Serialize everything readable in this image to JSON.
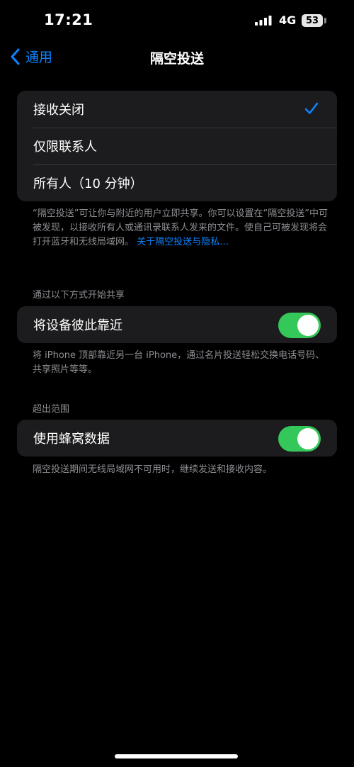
{
  "status_bar": {
    "time": "17:21",
    "network": "4G",
    "battery": "53"
  },
  "nav": {
    "back_label": "通用",
    "title": "隔空投送"
  },
  "receive_options": [
    {
      "label": "接收关闭",
      "selected": true
    },
    {
      "label": "仅限联系人",
      "selected": false
    },
    {
      "label": "所有人（10 分钟）",
      "selected": false
    }
  ],
  "receive_footnote": {
    "text": "“隔空投送”可让你与附近的用户立即共享。你可以设置在“隔空投送”中可被发现，以接收所有人或通讯录联系人发来的文件。使自己可被发现将会打开蓝牙和无线局域网。",
    "link": "关于隔空投送与隐私…"
  },
  "start_sharing": {
    "header": "通过以下方式开始共享",
    "row_label": "将设备彼此靠近",
    "toggle_on": true,
    "footnote": "将 iPhone 顶部靠近另一台 iPhone，通过名片投送轻松交换电话号码、共享照片等等。"
  },
  "out_of_range": {
    "header": "超出范围",
    "row_label": "使用蜂窝数据",
    "toggle_on": true,
    "footnote": "隔空投送期间无线局域网不可用时，继续发送和接收内容。"
  },
  "colors": {
    "accent": "#0a84ff",
    "toggle_on": "#34c759",
    "group_bg": "#1c1c1e"
  }
}
